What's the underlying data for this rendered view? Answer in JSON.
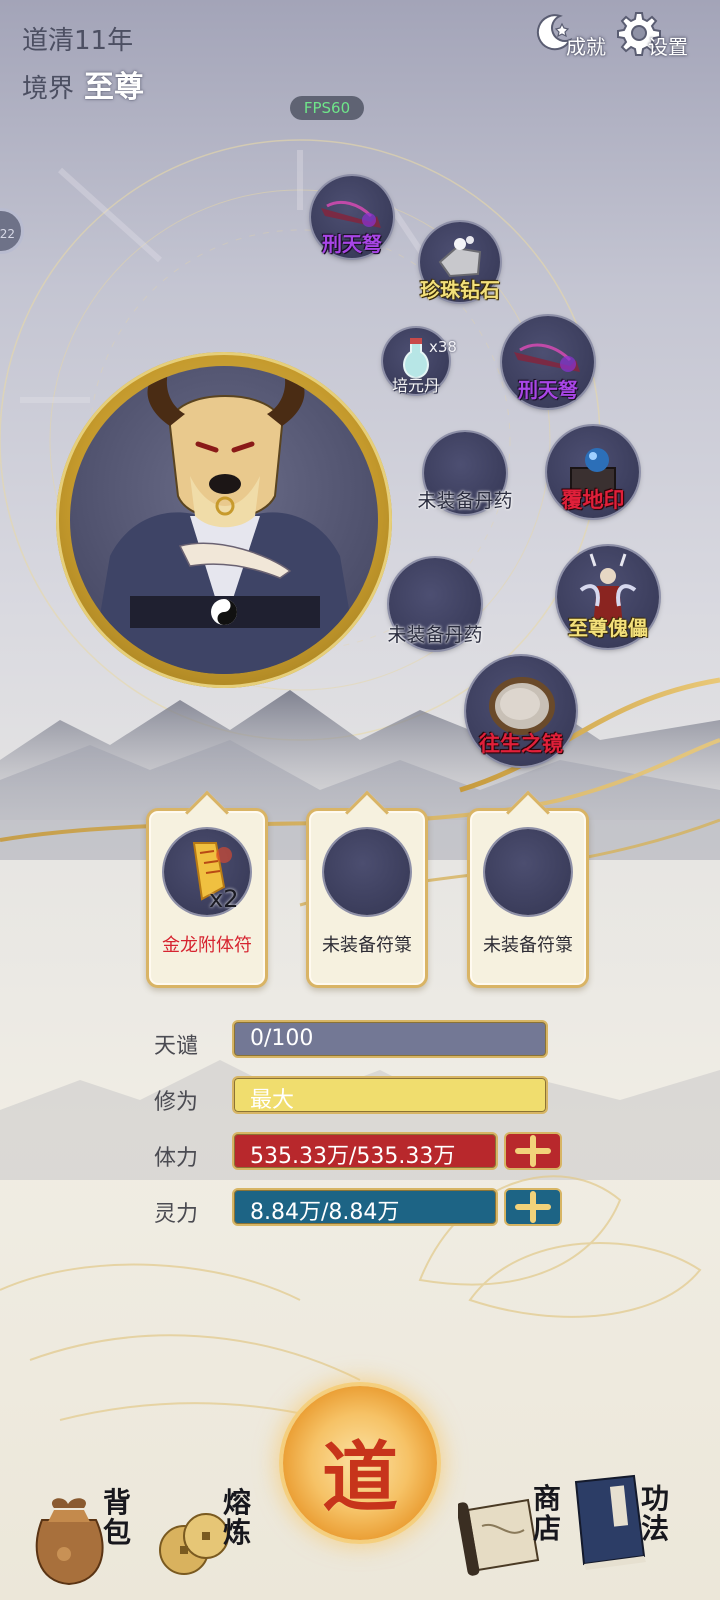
{
  "header": {
    "era": "道清11年",
    "realm_label": "境界",
    "realm_value": "至尊",
    "fps": "FPS60",
    "achievements_label": "成就",
    "settings_label": "设置",
    "side_tab_text": "22"
  },
  "equipment": [
    {
      "name": "刑天弩",
      "tier": "purple",
      "icon": "crossbow-icon"
    },
    {
      "name": "珍珠钻石",
      "tier": "yellow",
      "icon": "gem-icon"
    },
    {
      "name": "培元丹",
      "tier": "white",
      "icon": "potion-icon",
      "count": "x38"
    },
    {
      "name": "刑天弩",
      "tier": "purple",
      "icon": "crossbow-icon"
    },
    {
      "name": "未装备丹药",
      "tier": "empty"
    },
    {
      "name": "覆地印",
      "tier": "red",
      "icon": "seal-icon"
    },
    {
      "name": "未装备丹药",
      "tier": "empty"
    },
    {
      "name": "至尊傀儡",
      "tier": "yellow",
      "icon": "puppet-icon"
    },
    {
      "name": "往生之镜",
      "tier": "red",
      "icon": "mirror-icon"
    }
  ],
  "talismans": [
    {
      "name": "金龙附体符",
      "count": "x2",
      "equipped": true,
      "icon": "golden-talisman-icon"
    },
    {
      "name": "未装备符箓",
      "equipped": false
    },
    {
      "name": "未装备符箓",
      "equipped": false
    }
  ],
  "stats": {
    "tianqian": {
      "label": "天谴",
      "value": "0/100",
      "fraction": 0.0,
      "color": "#737895"
    },
    "xiuwei": {
      "label": "修为",
      "value": "最大",
      "fraction": 1.0,
      "color": "#f0dd6e"
    },
    "tili": {
      "label": "体力",
      "value": "535.33万/535.33万",
      "fraction": 1.0,
      "color": "#b8282c"
    },
    "lingli": {
      "label": "灵力",
      "value": "8.84万/8.84万",
      "fraction": 1.0,
      "color": "#1d6485"
    }
  },
  "nav": {
    "bag_label": "背包",
    "refine_label": "熔炼",
    "dao_label": "道",
    "shop_label": "商店",
    "skills_label": "功法"
  }
}
